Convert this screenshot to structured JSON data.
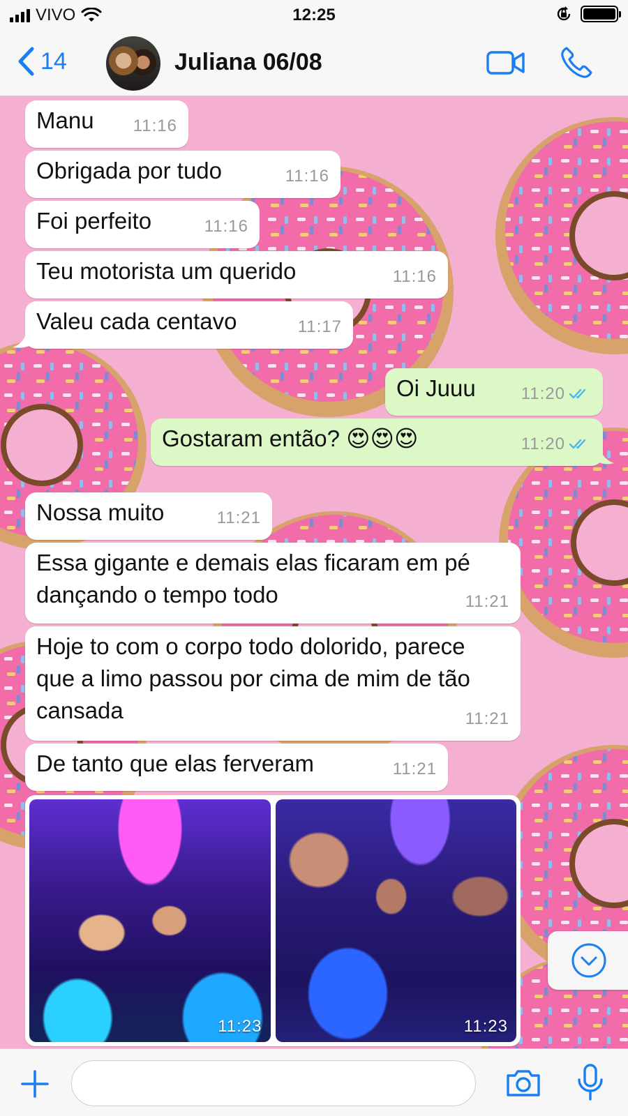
{
  "status_bar": {
    "carrier": "VIVO",
    "time": "12:25"
  },
  "header": {
    "back_count": "14",
    "contact_name": "Juliana 06/08"
  },
  "messages": [
    {
      "text": "Manu",
      "time": "11:16",
      "direction": "incoming"
    },
    {
      "text": "Obrigada por tudo",
      "time": "11:16",
      "direction": "incoming"
    },
    {
      "text": "Foi perfeito",
      "time": "11:16",
      "direction": "incoming"
    },
    {
      "text": "Teu motorista um querido",
      "time": "11:16",
      "direction": "incoming"
    },
    {
      "text": "Valeu cada centavo",
      "time": "11:17",
      "direction": "incoming"
    },
    {
      "text": "Oi Juuu",
      "time": "11:20",
      "direction": "outgoing",
      "status": "read"
    },
    {
      "text": "Gostaram então? 😍😍😍",
      "time": "11:20",
      "direction": "outgoing",
      "status": "read"
    },
    {
      "text": "Nossa muito",
      "time": "11:21",
      "direction": "incoming"
    },
    {
      "text": "Essa gigante e demais elas ficaram em pé dançando o tempo todo",
      "time": "11:21",
      "direction": "incoming"
    },
    {
      "text": "Hoje to com o corpo todo dolorido, parece que a limo passou por cima de mim de tão cansada",
      "time": "11:21",
      "direction": "incoming"
    },
    {
      "text": "De tanto que elas ferveram",
      "time": "11:21",
      "direction": "incoming"
    }
  ],
  "photos": [
    {
      "time": "11:23"
    },
    {
      "time": "11:23"
    }
  ],
  "icons": {
    "back": "chevron-left-icon",
    "video": "video-camera-icon",
    "call": "phone-icon",
    "scroll": "chevron-down-circle-icon",
    "attach": "plus-icon",
    "camera": "camera-icon",
    "mic": "microphone-icon"
  },
  "colors": {
    "accent": "#1a7ff0",
    "outgoing_bubble": "#dcf8c6",
    "incoming_bubble": "#ffffff",
    "wallpaper": "#f4afd1",
    "read_ticks": "#4fb6ec"
  },
  "composer": {
    "value": "",
    "placeholder": ""
  }
}
